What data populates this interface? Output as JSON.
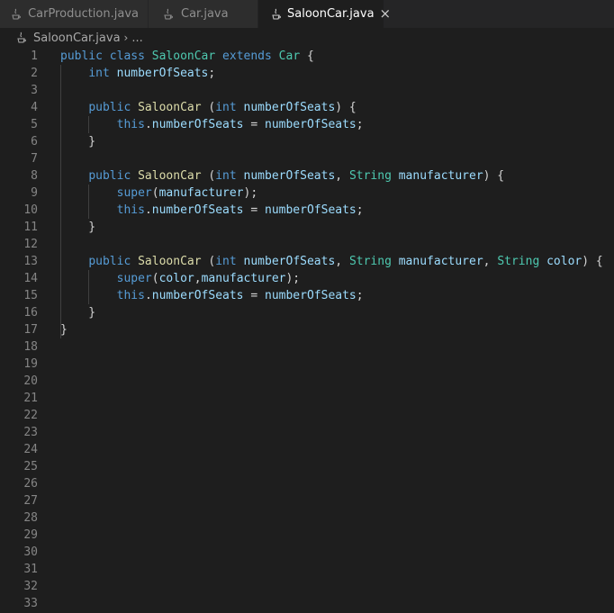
{
  "tabs": [
    {
      "label": "CarProduction.java",
      "icon": "java-icon",
      "active": false
    },
    {
      "label": "Car.java",
      "icon": "java-icon",
      "active": false
    },
    {
      "label": "SaloonCar.java",
      "icon": "java-icon",
      "active": true,
      "close": "×"
    }
  ],
  "breadcrumb": {
    "file": "SaloonCar.java",
    "separator": "›",
    "more": "..."
  },
  "editor": {
    "line_numbers": [
      "1",
      "2",
      "3",
      "4",
      "5",
      "6",
      "7",
      "8",
      "9",
      "10",
      "11",
      "12",
      "13",
      "14",
      "15",
      "16",
      "17",
      "18",
      "19",
      "20",
      "21",
      "22",
      "23",
      "24",
      "25",
      "26",
      "27",
      "28",
      "29",
      "30",
      "31",
      "32",
      "33"
    ],
    "code_lines": [
      [
        {
          "t": "kw",
          "v": "public"
        },
        {
          "t": "pl",
          "v": " "
        },
        {
          "t": "kw",
          "v": "class"
        },
        {
          "t": "pl",
          "v": " "
        },
        {
          "t": "cls",
          "v": "SaloonCar"
        },
        {
          "t": "pl",
          "v": " "
        },
        {
          "t": "kw",
          "v": "extends"
        },
        {
          "t": "pl",
          "v": " "
        },
        {
          "t": "cls",
          "v": "Car"
        },
        {
          "t": "pl",
          "v": " {"
        }
      ],
      [
        {
          "t": "pl",
          "v": "    "
        },
        {
          "t": "kw",
          "v": "int"
        },
        {
          "t": "pl",
          "v": " "
        },
        {
          "t": "var",
          "v": "numberOfSeats"
        },
        {
          "t": "pl",
          "v": ";"
        }
      ],
      [],
      [
        {
          "t": "pl",
          "v": "    "
        },
        {
          "t": "kw",
          "v": "public"
        },
        {
          "t": "pl",
          "v": " "
        },
        {
          "t": "fn",
          "v": "SaloonCar"
        },
        {
          "t": "pl",
          "v": " ("
        },
        {
          "t": "kw",
          "v": "int"
        },
        {
          "t": "pl",
          "v": " "
        },
        {
          "t": "var",
          "v": "numberOfSeats"
        },
        {
          "t": "pl",
          "v": ") {"
        }
      ],
      [
        {
          "t": "pl",
          "v": "        "
        },
        {
          "t": "kw",
          "v": "this"
        },
        {
          "t": "pl",
          "v": "."
        },
        {
          "t": "var",
          "v": "numberOfSeats"
        },
        {
          "t": "pl",
          "v": " = "
        },
        {
          "t": "var",
          "v": "numberOfSeats"
        },
        {
          "t": "pl",
          "v": ";"
        }
      ],
      [
        {
          "t": "pl",
          "v": "    }"
        }
      ],
      [],
      [
        {
          "t": "pl",
          "v": "    "
        },
        {
          "t": "kw",
          "v": "public"
        },
        {
          "t": "pl",
          "v": " "
        },
        {
          "t": "fn",
          "v": "SaloonCar"
        },
        {
          "t": "pl",
          "v": " ("
        },
        {
          "t": "kw",
          "v": "int"
        },
        {
          "t": "pl",
          "v": " "
        },
        {
          "t": "var",
          "v": "numberOfSeats"
        },
        {
          "t": "pl",
          "v": ", "
        },
        {
          "t": "cls",
          "v": "String"
        },
        {
          "t": "pl",
          "v": " "
        },
        {
          "t": "var",
          "v": "manufacturer"
        },
        {
          "t": "pl",
          "v": ") {"
        }
      ],
      [
        {
          "t": "pl",
          "v": "        "
        },
        {
          "t": "kw",
          "v": "super"
        },
        {
          "t": "pl",
          "v": "("
        },
        {
          "t": "var",
          "v": "manufacturer"
        },
        {
          "t": "pl",
          "v": ");"
        }
      ],
      [
        {
          "t": "pl",
          "v": "        "
        },
        {
          "t": "kw",
          "v": "this"
        },
        {
          "t": "pl",
          "v": "."
        },
        {
          "t": "var",
          "v": "numberOfSeats"
        },
        {
          "t": "pl",
          "v": " = "
        },
        {
          "t": "var",
          "v": "numberOfSeats"
        },
        {
          "t": "pl",
          "v": ";"
        }
      ],
      [
        {
          "t": "pl",
          "v": "    }"
        }
      ],
      [],
      [
        {
          "t": "pl",
          "v": "    "
        },
        {
          "t": "kw",
          "v": "public"
        },
        {
          "t": "pl",
          "v": " "
        },
        {
          "t": "fn",
          "v": "SaloonCar"
        },
        {
          "t": "pl",
          "v": " ("
        },
        {
          "t": "kw",
          "v": "int"
        },
        {
          "t": "pl",
          "v": " "
        },
        {
          "t": "var",
          "v": "numberOfSeats"
        },
        {
          "t": "pl",
          "v": ", "
        },
        {
          "t": "cls",
          "v": "String"
        },
        {
          "t": "pl",
          "v": " "
        },
        {
          "t": "var",
          "v": "manufacturer"
        },
        {
          "t": "pl",
          "v": ", "
        },
        {
          "t": "cls",
          "v": "String"
        },
        {
          "t": "pl",
          "v": " "
        },
        {
          "t": "var",
          "v": "color"
        },
        {
          "t": "pl",
          "v": ") {"
        }
      ],
      [
        {
          "t": "pl",
          "v": "        "
        },
        {
          "t": "kw",
          "v": "super"
        },
        {
          "t": "pl",
          "v": "("
        },
        {
          "t": "var",
          "v": "color"
        },
        {
          "t": "pl",
          "v": ","
        },
        {
          "t": "var",
          "v": "manufacturer"
        },
        {
          "t": "pl",
          "v": ");"
        }
      ],
      [
        {
          "t": "pl",
          "v": "        "
        },
        {
          "t": "kw",
          "v": "this"
        },
        {
          "t": "pl",
          "v": "."
        },
        {
          "t": "var",
          "v": "numberOfSeats"
        },
        {
          "t": "pl",
          "v": " = "
        },
        {
          "t": "var",
          "v": "numberOfSeats"
        },
        {
          "t": "pl",
          "v": ";"
        }
      ],
      [
        {
          "t": "pl",
          "v": "    }"
        }
      ],
      [
        {
          "t": "pl",
          "v": "}"
        }
      ]
    ]
  },
  "colors": {
    "background": "#1e1e1e",
    "keyword": "#569cd6",
    "class": "#4ec9b0",
    "function": "#dcdcaa",
    "variable": "#9cdcfe",
    "plain": "#d4d4d4",
    "line_number": "#858585"
  }
}
